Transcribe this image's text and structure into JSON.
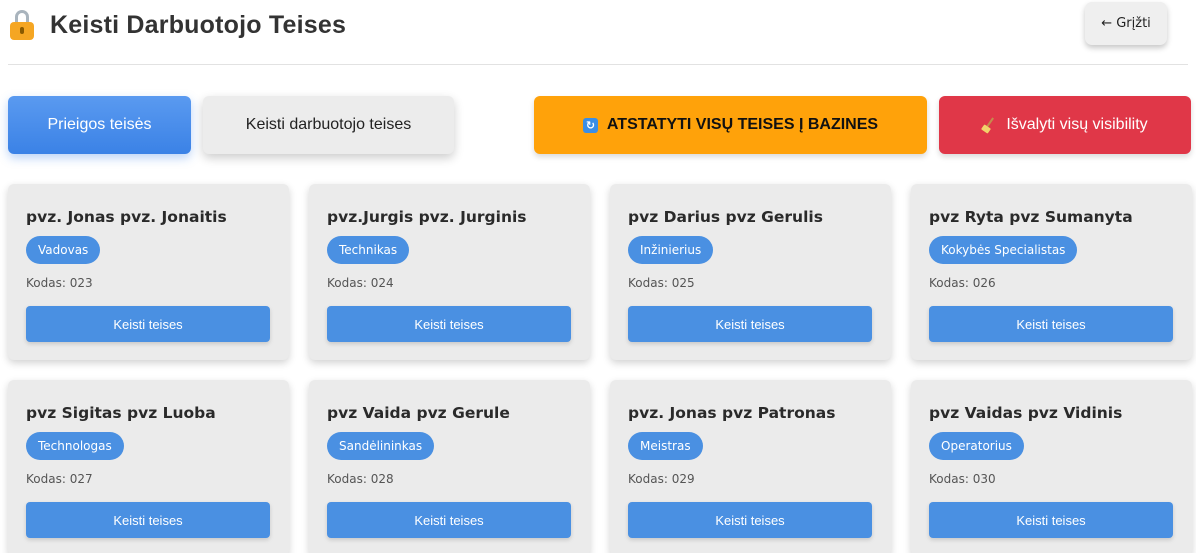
{
  "header": {
    "title": "Keisti Darbuotojo Teises",
    "back_label": "← Grįžti"
  },
  "toolbar": {
    "access_rights_label": "Prieigos teisės",
    "edit_rights_label": "Keisti darbuotojo teises",
    "reset_all_label": "ATSTATYTI VISŲ TEISES Į BAZINES",
    "clear_visibility_label": "Išvalyti visų visibility"
  },
  "colors": {
    "primary": "#4a90e2",
    "warning": "#ffa20a",
    "danger": "#e03748"
  },
  "employees": [
    {
      "name": "pvz. Jonas pvz. Jonaitis",
      "role": "Vadovas",
      "code": "Kodas: 023",
      "action": "Keisti teises"
    },
    {
      "name": "pvz.Jurgis pvz. Jurginis",
      "role": "Technikas",
      "code": "Kodas: 024",
      "action": "Keisti teises"
    },
    {
      "name": "pvz Darius pvz Gerulis",
      "role": "Inžinierius",
      "code": "Kodas: 025",
      "action": "Keisti teises"
    },
    {
      "name": "pvz Ryta pvz Sumanyta",
      "role": "Kokybės Specialistas",
      "code": "Kodas: 026",
      "action": "Keisti teises"
    },
    {
      "name": "pvz Sigitas pvz Luoba",
      "role": "Technologas",
      "code": "Kodas: 027",
      "action": "Keisti teises"
    },
    {
      "name": "pvz Vaida pvz Gerule",
      "role": "Sandėlininkas",
      "code": "Kodas: 028",
      "action": "Keisti teises"
    },
    {
      "name": "pvz. Jonas pvz Patronas",
      "role": "Meistras",
      "code": "Kodas: 029",
      "action": "Keisti teises"
    },
    {
      "name": "pvz Vaidas pvz Vidinis",
      "role": "Operatorius",
      "code": "Kodas: 030",
      "action": "Keisti teises"
    }
  ]
}
